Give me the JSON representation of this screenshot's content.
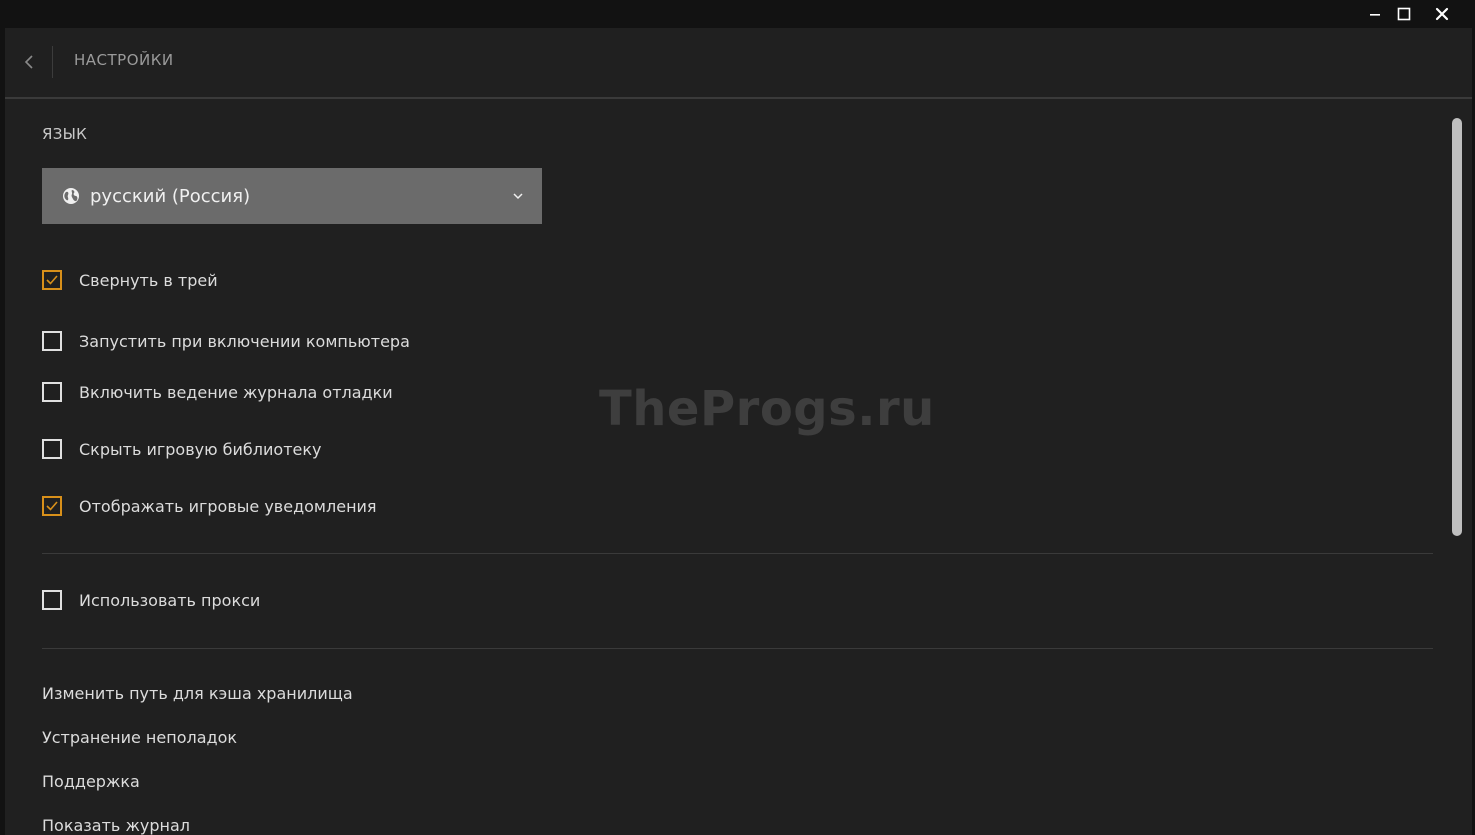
{
  "window_controls": {
    "minimize_icon": "minimize-icon",
    "maximize_icon": "maximize-icon",
    "close_icon": "close-icon"
  },
  "header": {
    "back_icon": "chevron-left-icon",
    "title": "НАСТРОЙКИ"
  },
  "language": {
    "label": "ЯЗЫК",
    "selected": "русский (Россия)",
    "icon": "globe-icon",
    "chevron_icon": "chevron-down-icon"
  },
  "checkboxes": [
    {
      "label": "Свернуть в трей",
      "checked": true
    },
    {
      "label": "Запустить при включении компьютера",
      "checked": false
    },
    {
      "label": "Включить ведение журнала отладки",
      "checked": false
    },
    {
      "label": "Скрыть игровую библиотеку",
      "checked": false
    },
    {
      "label": "Отображать игровые уведомления",
      "checked": true
    }
  ],
  "proxy": {
    "label": "Использовать прокси",
    "checked": false
  },
  "links": [
    "Изменить путь для кэша хранилища",
    "Устранение неполадок",
    "Поддержка",
    "Показать журнал"
  ],
  "watermark": "TheProgs.ru",
  "colors": {
    "background": "#202020",
    "titlebar": "#121212",
    "accent_checkbox": "#d8901a",
    "select_bg": "#6b6b6b"
  }
}
